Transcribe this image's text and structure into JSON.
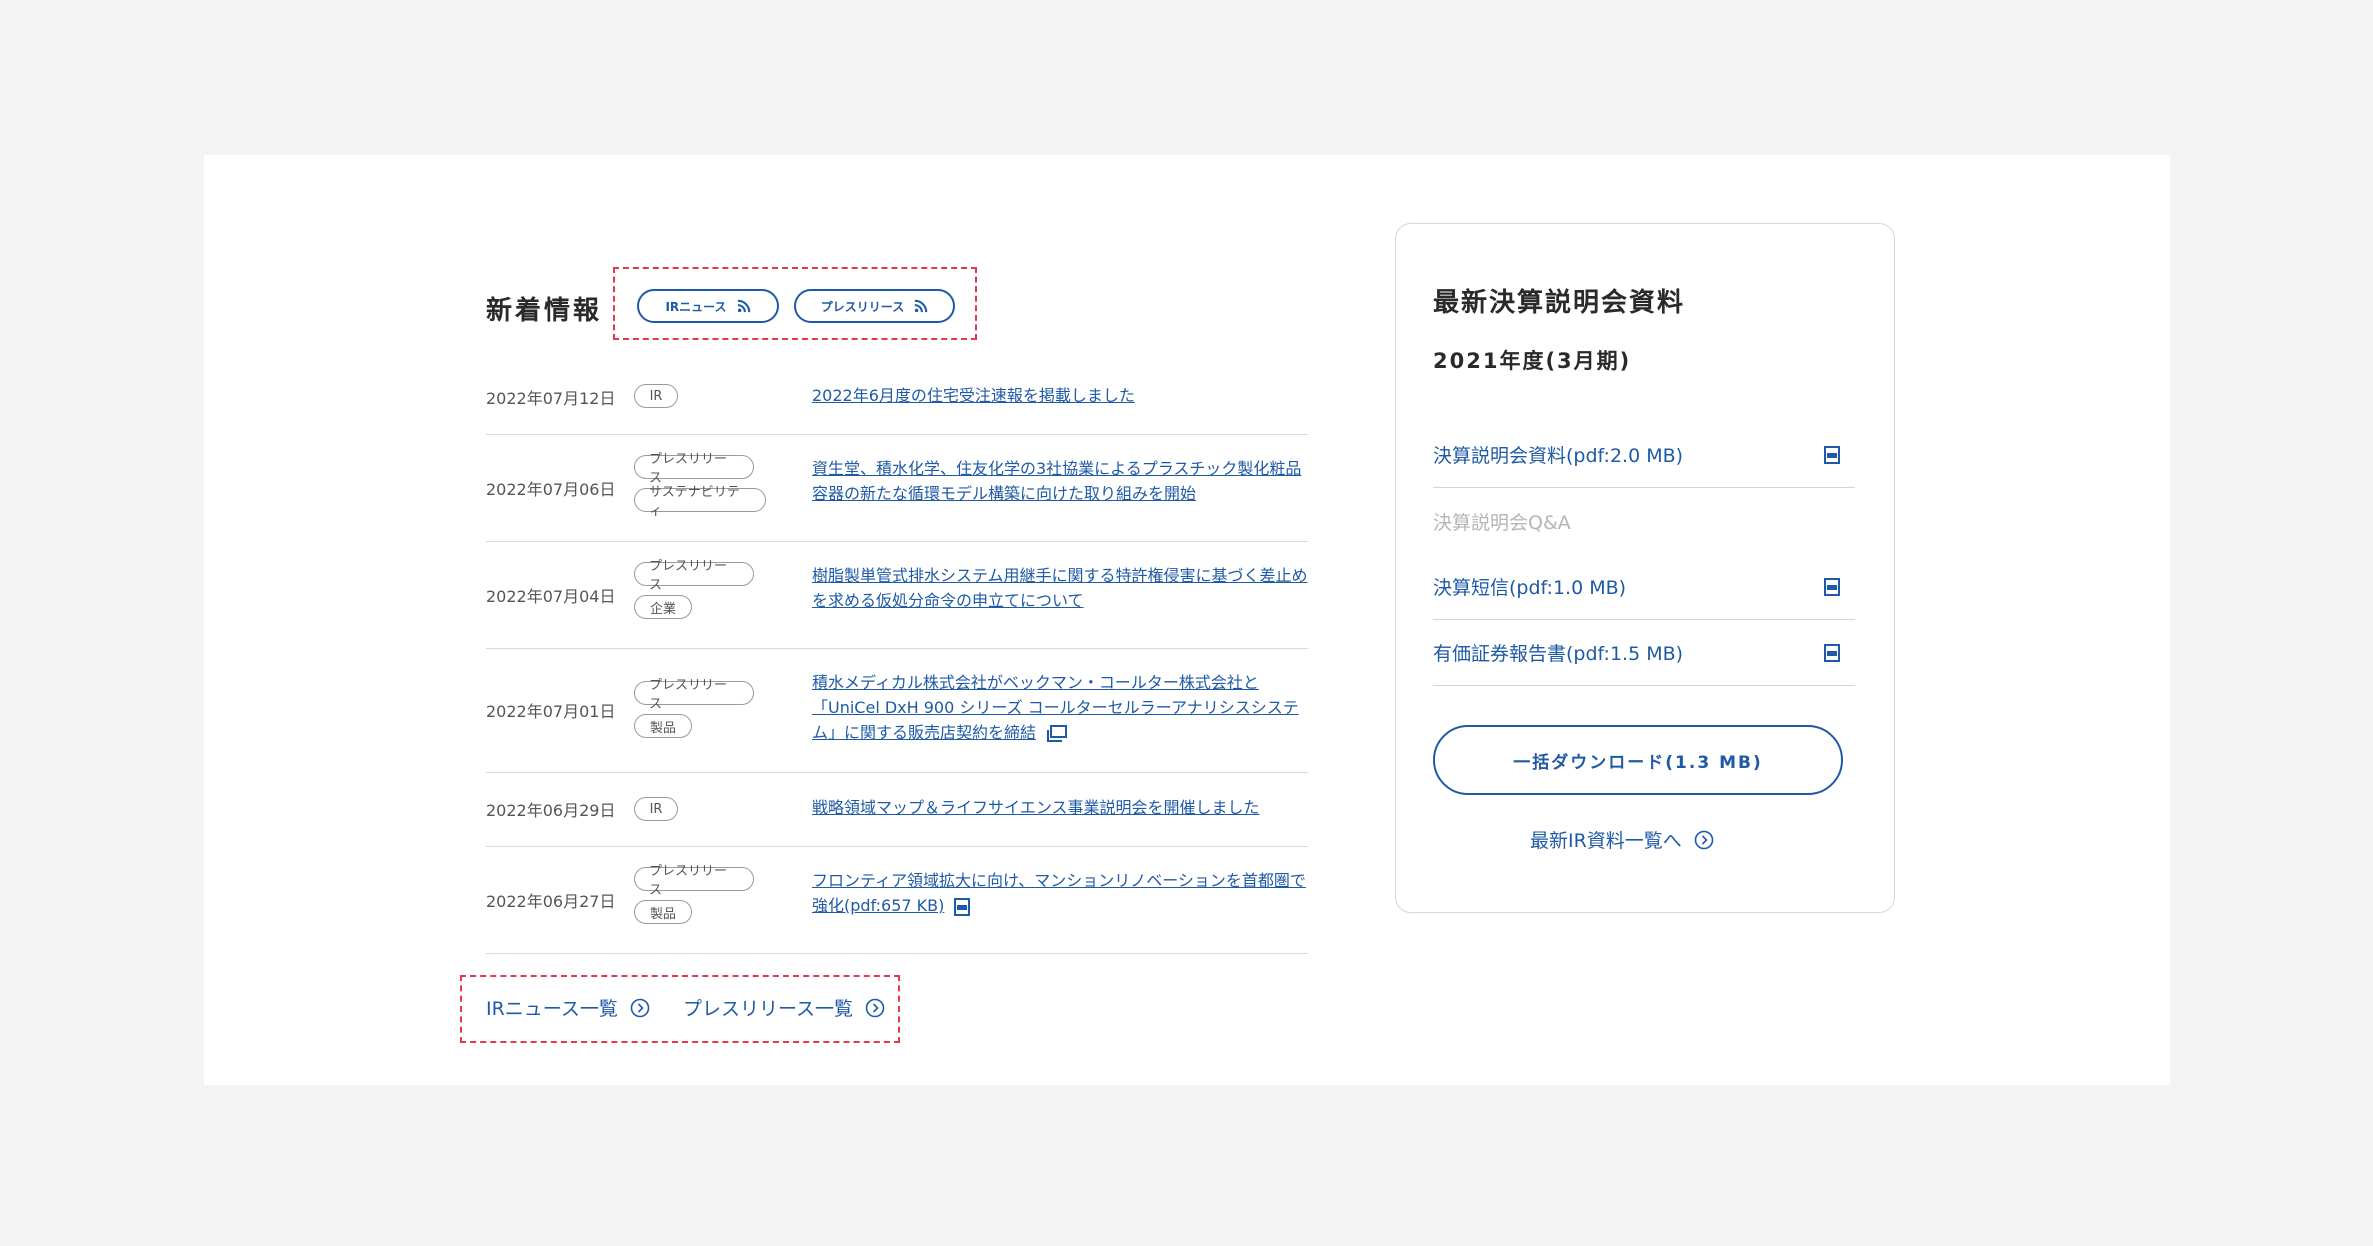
{
  "news": {
    "title": "新着情報",
    "feeds": [
      {
        "label": "IRニュース",
        "icon": "rss-icon"
      },
      {
        "label": "プレスリリース",
        "icon": "rss-icon"
      }
    ],
    "items": [
      {
        "date": "2022年07月12日",
        "tags": [
          "IR"
        ],
        "text": "2022年6月度の住宅受注速報を掲載しました"
      },
      {
        "date": "2022年07月06日",
        "tags": [
          "プレスリリース",
          "サステナビリティ"
        ],
        "text": "資生堂、積水化学、住友化学の3社協業によるプラスチック製化粧品容器の新たな循環モデル構築に向けた取り組みを開始"
      },
      {
        "date": "2022年07月04日",
        "tags": [
          "プレスリリース",
          "企業"
        ],
        "text": "樹脂製単管式排水システム用継手に関する特許権侵害に基づく差止めを求める仮処分命令の申立てについて"
      },
      {
        "date": "2022年07月01日",
        "tags": [
          "プレスリリース",
          "製品"
        ],
        "text": "積水メディカル株式会社がベックマン・コールター株式会社と「UniCel DxH 900 シリーズ コールターセルラーアナリシスシステム」に関する販売店契約を締結",
        "icon": "external-window-icon"
      },
      {
        "date": "2022年06月29日",
        "tags": [
          "IR"
        ],
        "text": "戦略領域マップ＆ライフサイエンス事業説明会を開催しました"
      },
      {
        "date": "2022年06月27日",
        "tags": [
          "プレスリリース",
          "製品"
        ],
        "text": "フロンティア領域拡大に向け、マンションリノベーションを首都圏で強化(pdf:657 KB)",
        "icon": "pdf-icon"
      }
    ],
    "more": [
      {
        "label": "IRニュース一覧",
        "icon": "circle-chevron-right-icon"
      },
      {
        "label": "プレスリリース一覧",
        "icon": "circle-chevron-right-icon"
      }
    ]
  },
  "financial": {
    "title": "最新決算説明会資料",
    "period": "2021年度(3月期)",
    "docs": [
      {
        "label": "決算説明会資料(pdf:2.0 MB)",
        "icon": "pdf-icon",
        "enabled": true
      },
      {
        "label": "決算説明会Q&A",
        "enabled": false
      },
      {
        "label": "決算短信(pdf:1.0 MB)",
        "icon": "pdf-icon",
        "enabled": true
      },
      {
        "label": "有価証券報告書(pdf:1.5 MB)",
        "icon": "pdf-icon",
        "enabled": true
      }
    ],
    "download_label": "一括ダウンロード(1.3 MB)",
    "more_label": "最新IR資料一覧へ"
  },
  "colors": {
    "accent": "#1f5aa6",
    "highlight_dash": "#e23a4a",
    "background": "#f4f4f5",
    "card": "#ffffff"
  }
}
